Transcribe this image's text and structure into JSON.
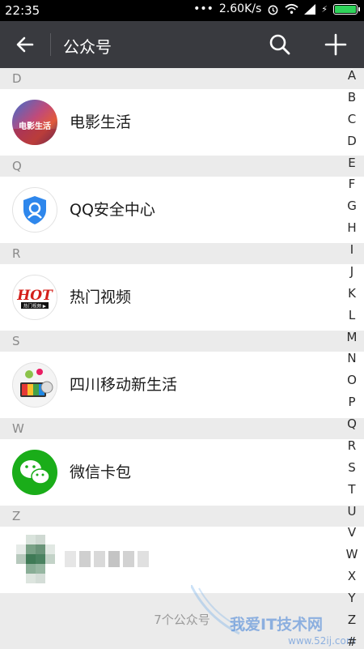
{
  "status_bar": {
    "time": "22:35",
    "network_speed": "2.60K/s",
    "battery_level": 1.0
  },
  "app_bar": {
    "title": "公众号"
  },
  "sections": [
    {
      "header": "D",
      "items": [
        {
          "name": "电影生活",
          "icon": "movie-life-avatar"
        }
      ]
    },
    {
      "header": "Q",
      "items": [
        {
          "name": "QQ安全中心",
          "icon": "qq-security-avatar"
        }
      ]
    },
    {
      "header": "R",
      "items": [
        {
          "name": "热门视频",
          "icon": "hot-video-avatar",
          "logo_text": "HOT",
          "logo_subtext": "热门视频 ▶"
        }
      ]
    },
    {
      "header": "S",
      "items": [
        {
          "name": "四川移动新生活",
          "icon": "sichuan-mobile-avatar"
        }
      ]
    },
    {
      "header": "W",
      "items": [
        {
          "name": "微信卡包",
          "icon": "wechat-card-avatar"
        }
      ]
    },
    {
      "header": "Z",
      "items": [
        {
          "name": "",
          "icon": "blurred-avatar"
        }
      ]
    }
  ],
  "footer": {
    "count_text": "7个公众号"
  },
  "index_letters": [
    "A",
    "B",
    "C",
    "D",
    "E",
    "F",
    "G",
    "H",
    "I",
    "J",
    "K",
    "L",
    "M",
    "N",
    "O",
    "P",
    "Q",
    "R",
    "S",
    "T",
    "U",
    "V",
    "W",
    "X",
    "Y",
    "Z",
    "#"
  ],
  "watermark": {
    "text": "我爱IT技术网",
    "url": "www.52ij.com"
  },
  "colors": {
    "app_bar": "#393a3f",
    "wechat_green": "#1aad19",
    "qq_blue": "#2e87ec"
  }
}
